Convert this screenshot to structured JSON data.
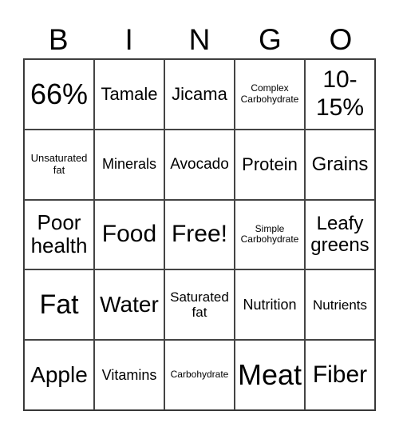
{
  "header": [
    "B",
    "I",
    "N",
    "G",
    "O"
  ],
  "cells": [
    [
      "66%",
      "Tamale",
      "Jicama",
      "Complex Carbohydrate",
      "10-15%"
    ],
    [
      "Unsaturated fat",
      "Minerals",
      "Avocado",
      "Protein",
      "Grains"
    ],
    [
      "Poor health",
      "Food",
      "Free!",
      "Simple Carbohydrate",
      "Leafy greens"
    ],
    [
      "Fat",
      "Water",
      "Saturated fat",
      "Nutrition",
      "Nutrients"
    ],
    [
      "Apple",
      "Vitamins",
      "Carbohydrate",
      "Meat",
      "Fiber"
    ]
  ]
}
